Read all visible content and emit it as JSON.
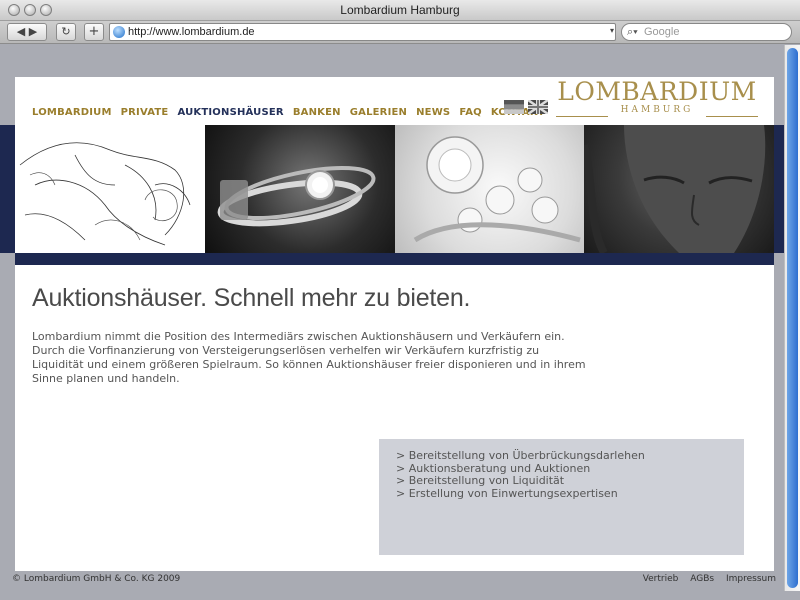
{
  "browser": {
    "window_title": "Lombardium Hamburg",
    "url": "http://www.lombardium.de",
    "search_placeholder": "Google",
    "back_label": "◀ ▶",
    "reload_label": "↻",
    "add_label": "+"
  },
  "nav": {
    "items": [
      "LOMBARDIUM",
      "PRIVATE",
      "AUKTIONSHÄUSER",
      "BANKEN",
      "GALERIEN",
      "NEWS",
      "FAQ",
      "KONTAKT"
    ],
    "active": "AUKTIONSHÄUSER"
  },
  "logo": {
    "main": "LOMBARDIUM",
    "sub": "HAMBURG"
  },
  "colors": {
    "navy": "#1d2850",
    "gold": "#9a7e2c",
    "gray_background": "#a9abb3"
  },
  "content": {
    "heading": "Auktionshäuser. Schnell mehr zu bieten.",
    "paragraph": "Lombardium nimmt die Position des Intermediärs zwischen Auktionshäusern und Verkäufern ein. Durch die Vorfinanzierung von Versteigerungserlösen verhelfen wir Verkäufern kurzfristig zu Liquidität und einem größeren Spielraum. So können Auktionshäuser freier disponieren und in ihrem Sinne planen und handeln.",
    "services": [
      "> Bereitstellung von Überbrückungsdarlehen",
      "> Auktionsberatung und Auktionen",
      "> Bereitstellung von Liquidität",
      "> Erstellung von Einwertungsexpertisen"
    ]
  },
  "footer": {
    "copyright": "© Lombardium GmbH & Co. KG 2009",
    "links": [
      "Vertrieb",
      "AGBs",
      "Impressum"
    ]
  }
}
